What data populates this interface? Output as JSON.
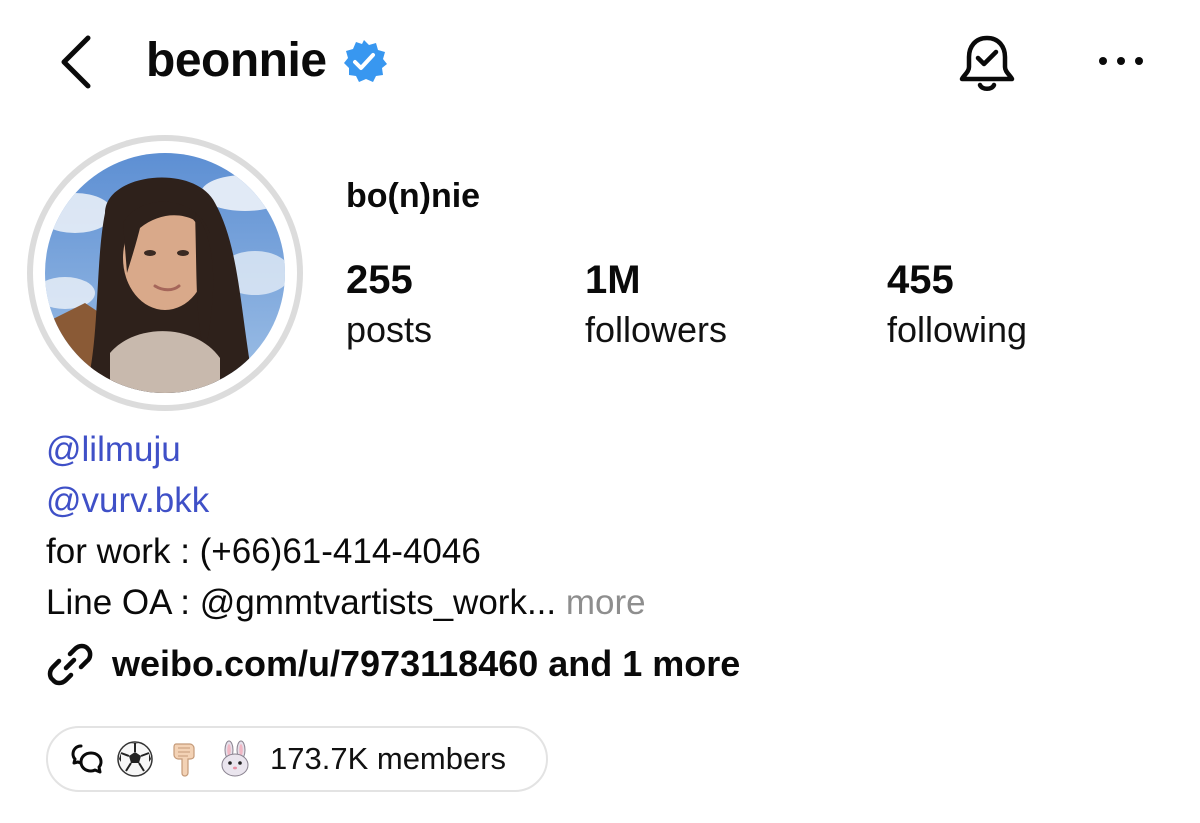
{
  "header": {
    "username": "beonnie",
    "verified": true,
    "icons": {
      "back": "chevron-left-icon",
      "verified": "verified-badge-icon",
      "bell": "notification-bell-icon",
      "more": "more-horizontal-icon"
    }
  },
  "profile": {
    "display_name": "bo(n)nie",
    "stats": [
      {
        "value": "255",
        "label": "posts"
      },
      {
        "value": "1M",
        "label": "followers"
      },
      {
        "value": "455",
        "label": "following"
      }
    ]
  },
  "bio": {
    "mentions": [
      "@lilmuju",
      "@vurv.bkk"
    ],
    "lines": [
      "for work : (+66)61-414-4046",
      "Line OA : @gmmtvartists_work..."
    ],
    "more_label": "more"
  },
  "link": {
    "text": "weibo.com/u/7973118460 and 1 more",
    "icon": "link-icon"
  },
  "channel": {
    "emojis": [
      "soccer-ball-icon",
      "pointing-down-hand-icon",
      "rabbit-face-icon"
    ],
    "members": "173.7K members"
  },
  "colors": {
    "mention": "#3f50c7",
    "verified": "#3897f0",
    "muted": "#8e8e8e",
    "text": "#0a0a0a"
  }
}
